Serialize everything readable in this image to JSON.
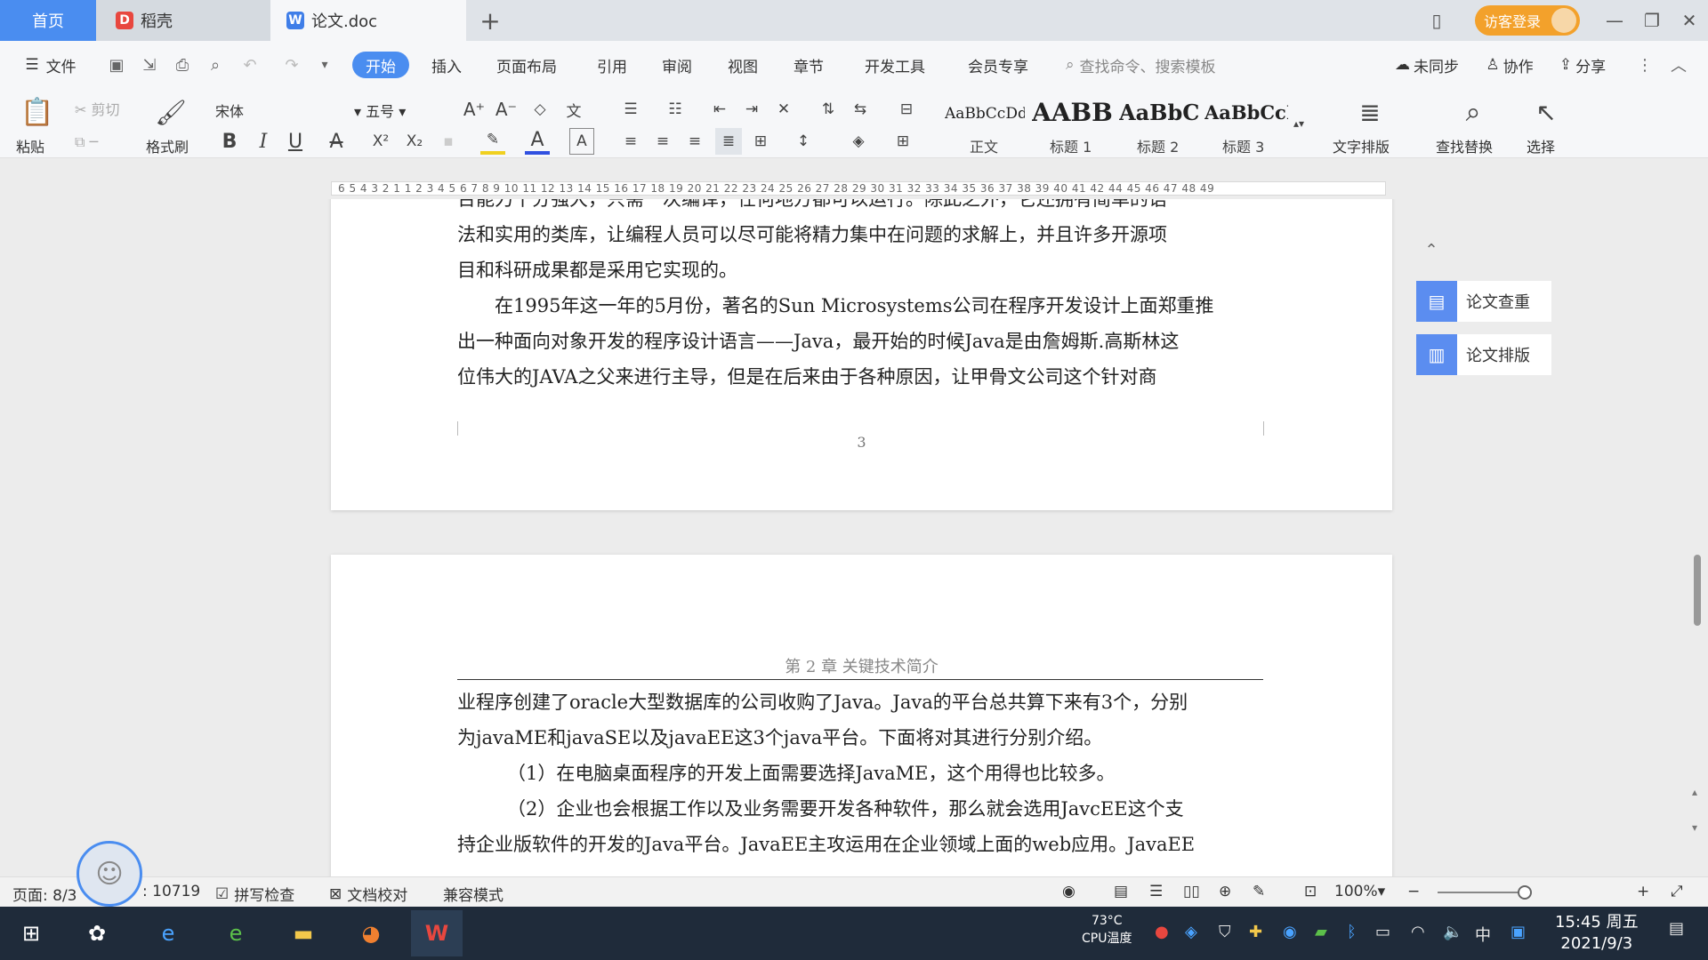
{
  "titlebar": {
    "tabs": [
      {
        "label": "首页"
      },
      {
        "label": "稻壳"
      },
      {
        "label": "论文.doc"
      }
    ],
    "login_label": "访客登录"
  },
  "menu": {
    "file": "文件",
    "items": [
      "开始",
      "插入",
      "页面布局",
      "引用",
      "审阅",
      "视图",
      "章节",
      "开发工具",
      "会员专享"
    ],
    "search_placeholder": "查找命令、搜索模板",
    "right": [
      "未同步",
      "协作",
      "分享"
    ]
  },
  "ribbon": {
    "paste": "粘贴",
    "cut": "剪切",
    "format_painter": "格式刷",
    "font": "宋体",
    "size": "五号",
    "styles": [
      {
        "preview": "AaBbCcDd",
        "label": "正文"
      },
      {
        "preview": "AABB",
        "label": "标题 1"
      },
      {
        "preview": "AaBbC",
        "label": "标题 2"
      },
      {
        "preview": "AaBbCcI",
        "label": "标题 3"
      }
    ],
    "text_layout": "文字排版",
    "find_replace": "查找替换",
    "select": "选择"
  },
  "ruler": {
    "ticks": "6 5 4 3 2 1   1 2 3 4 5 6 7 8 9 10 11 12 13 14 15 16 17 18 19 20 21 22 23 24 25 26 27 28 29 30 31 32 33 34 35 36 37 38 39 40 41 42   44 45 46 47 48 49"
  },
  "document": {
    "page1": {
      "lines": [
        "台能力十分强大，只需一次编译，任何地方都可以运行。除此之外，它还拥有简单的语",
        "法和实用的类库，让编程人员可以尽可能将精力集中在问题的求解上，并且许多开源项",
        "目和科研成果都是采用它实现的。",
        "在1995年这一年的5月份，著名的Sun Microsystems公司在程序开发设计上面郑重推",
        "出一种面向对象开发的程序设计语言——Java，最开始的时候Java是由詹姆斯.高斯林这",
        "位伟大的JAVA之父来进行主导，但是在后来由于各种原因，让甲骨文公司这个针对商"
      ],
      "page_number": "3"
    },
    "page2": {
      "header": "第 2 章  关键技术简介",
      "lines": [
        "业程序创建了oracle大型数据库的公司收购了Java。Java的平台总共算下来有3个，分别",
        "为javaME和javaSE以及javaEE这3个java平台。下面将对其进行分别介绍。",
        "（1）在电脑桌面程序的开发上面需要选择JavaME，这个用得也比较多。",
        "（2）企业也会根据工作以及业务需要开发各种软件，那么就会选用JavcEE这个支",
        "持企业版软件的开发的Java平台。JavaEE主攻运用在企业领域上面的web应用。JavaEE"
      ]
    }
  },
  "side_panel": {
    "check": "论文查重",
    "layout": "论文排版"
  },
  "status": {
    "page": "页面: 8/3",
    "words": ": 10719",
    "spell": "拼写检查",
    "proof": "文档校对",
    "compat": "兼容模式",
    "zoom": "100%"
  },
  "taskbar": {
    "cpu_temp": "73°C",
    "cpu_label": "CPU温度",
    "ime": "中",
    "time": "15:45 周五",
    "date": "2021/9/3"
  },
  "colors": {
    "accent": "#4a8df0",
    "login": "#f3a12b",
    "taskbar": "#1f2b3a"
  }
}
